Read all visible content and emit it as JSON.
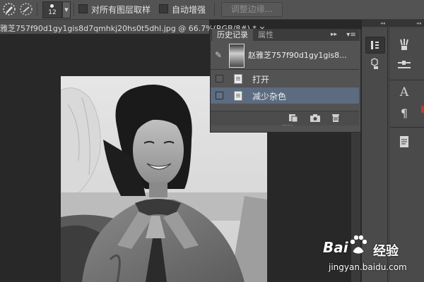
{
  "options_bar": {
    "brush_size": "12",
    "sample_all_layers_label": "对所有图层取样",
    "auto_enhance_label": "自动增强",
    "refine_edge_label": "调整边缘..."
  },
  "document": {
    "tab_title": "雅芝757f90d1gy1gis8d7qmhkj20hs0t5dhl.jpg @ 66.7%(RGB/8#) * ×"
  },
  "history_panel": {
    "tabs": [
      {
        "label": "历史记录"
      },
      {
        "label": "属性"
      }
    ],
    "collapse_glyph": "▸▸",
    "menu_glyph": "▾≡",
    "snapshot": {
      "name": "赵雅芝757f90d1gy1gis8..."
    },
    "states": [
      {
        "label": "打开"
      },
      {
        "label": "减少杂色"
      }
    ],
    "footer_icons": [
      "new-document-from-state-icon",
      "camera-icon",
      "trash-icon"
    ]
  },
  "dock": {
    "top_arrows": "◂◂"
  },
  "watermark": {
    "brand": "Bai",
    "brand_suffix": "经验",
    "url": "jingyan.baidu.com"
  },
  "colors": {
    "panel_bg": "#525252",
    "selected_state": "#5c6b80",
    "app_bg": "#282828",
    "toolbar_bg": "#535353"
  }
}
